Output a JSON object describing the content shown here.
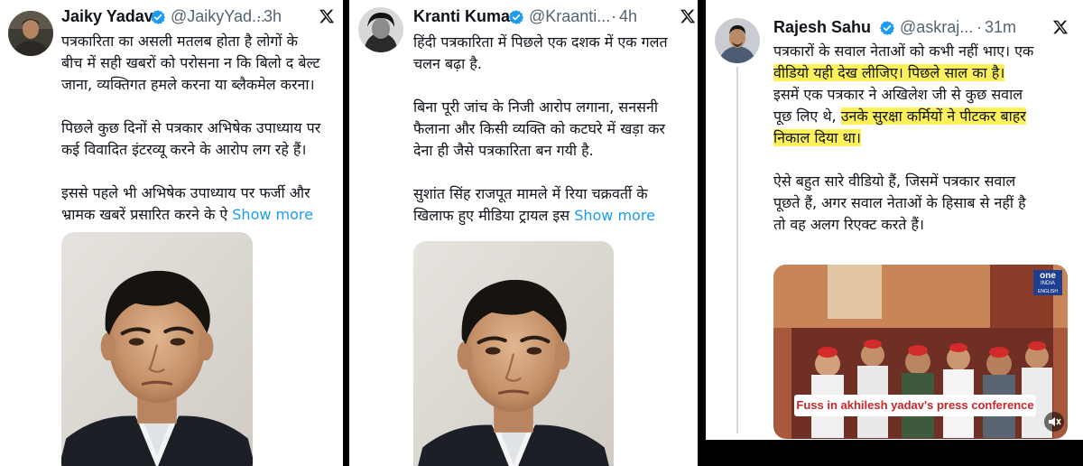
{
  "tweets": [
    {
      "name": "Jaiky Yadav",
      "handle": "@JaikyYad...",
      "sep": "·",
      "time": "3h",
      "lines": [
        "पत्रकारिता का असली मतलब होता है लोगों के",
        "बीच में सही खबरों को परोसना न कि बिलो द बेल्ट",
        "जाना, व्यक्तिगत हमले करना या ब्लैकमेल करना।",
        "पिछले कुछ दिनों से पत्रकार अभिषेक उपाध्याय पर",
        "कई विवादित इंटरव्यू करने के आरोप लग रहे हैं।",
        "इससे पहले भी अभिषेक उपाध्याय पर फर्जी और",
        "भ्रामक खबरें प्रसारित करने के ऐ"
      ],
      "show_more": "Show more"
    },
    {
      "name": "Kranti Kumar",
      "handle": "@Kraanti...",
      "sep": "·",
      "time": "4h",
      "lines": [
        "हिंदी पत्रकारिता में पिछले एक दशक में एक गलत",
        "चलन बढ़ा है.",
        "बिना पूरी जांच के निजी आरोप लगाना, सनसनी",
        "फैलाना और किसी व्यक्ति को कटघरे में खड़ा कर",
        "देना ही जैसे पत्रकारिता बन गयी है.",
        "सुशांत सिंह राजपूत मामले में रिया चक्रवर्ती के",
        "खिलाफ हुए मीडिया ट्रायल इस"
      ],
      "show_more": "Show more"
    },
    {
      "name": "Rajesh Sahu",
      "handle": "@askraj...",
      "sep": "·",
      "time": "31m",
      "lines": [
        "पत्रकारों के सवाल नेताओं को कभी नहीं भाए। एक",
        "वीडियो यही देख लीजिए। पिछले साल का है।",
        "इसमें एक पत्रकार ने अखिलेश जी से कुछ सवाल",
        "पूछ लिए थे, ",
        "उनके सुरक्षा कर्मियों ने पीटकर बाहर",
        "निकाल दिया था।",
        "ऐसे बहुत सारे वीडियो हैं, जिसमें पत्रकार सवाल",
        "पूछते हैं, अगर सवाल नेताओं के हिसाब से नहीं है",
        "तो वह अलग रिएक्ट करते हैं।"
      ],
      "video": {
        "caption": "Fuss in akhilesh yadav's press conference",
        "logo": "one",
        "logo_sub": "INDIA",
        "logo_lang": "ENGLISH"
      }
    }
  ],
  "colors": {
    "verified": "#1d9bf0",
    "link": "#1d9bf0",
    "highlight": "#fdf05a",
    "caption_text": "#c9262b"
  },
  "icons": [
    "verified-badge-icon",
    "x-logo-icon",
    "volume-icon"
  ]
}
